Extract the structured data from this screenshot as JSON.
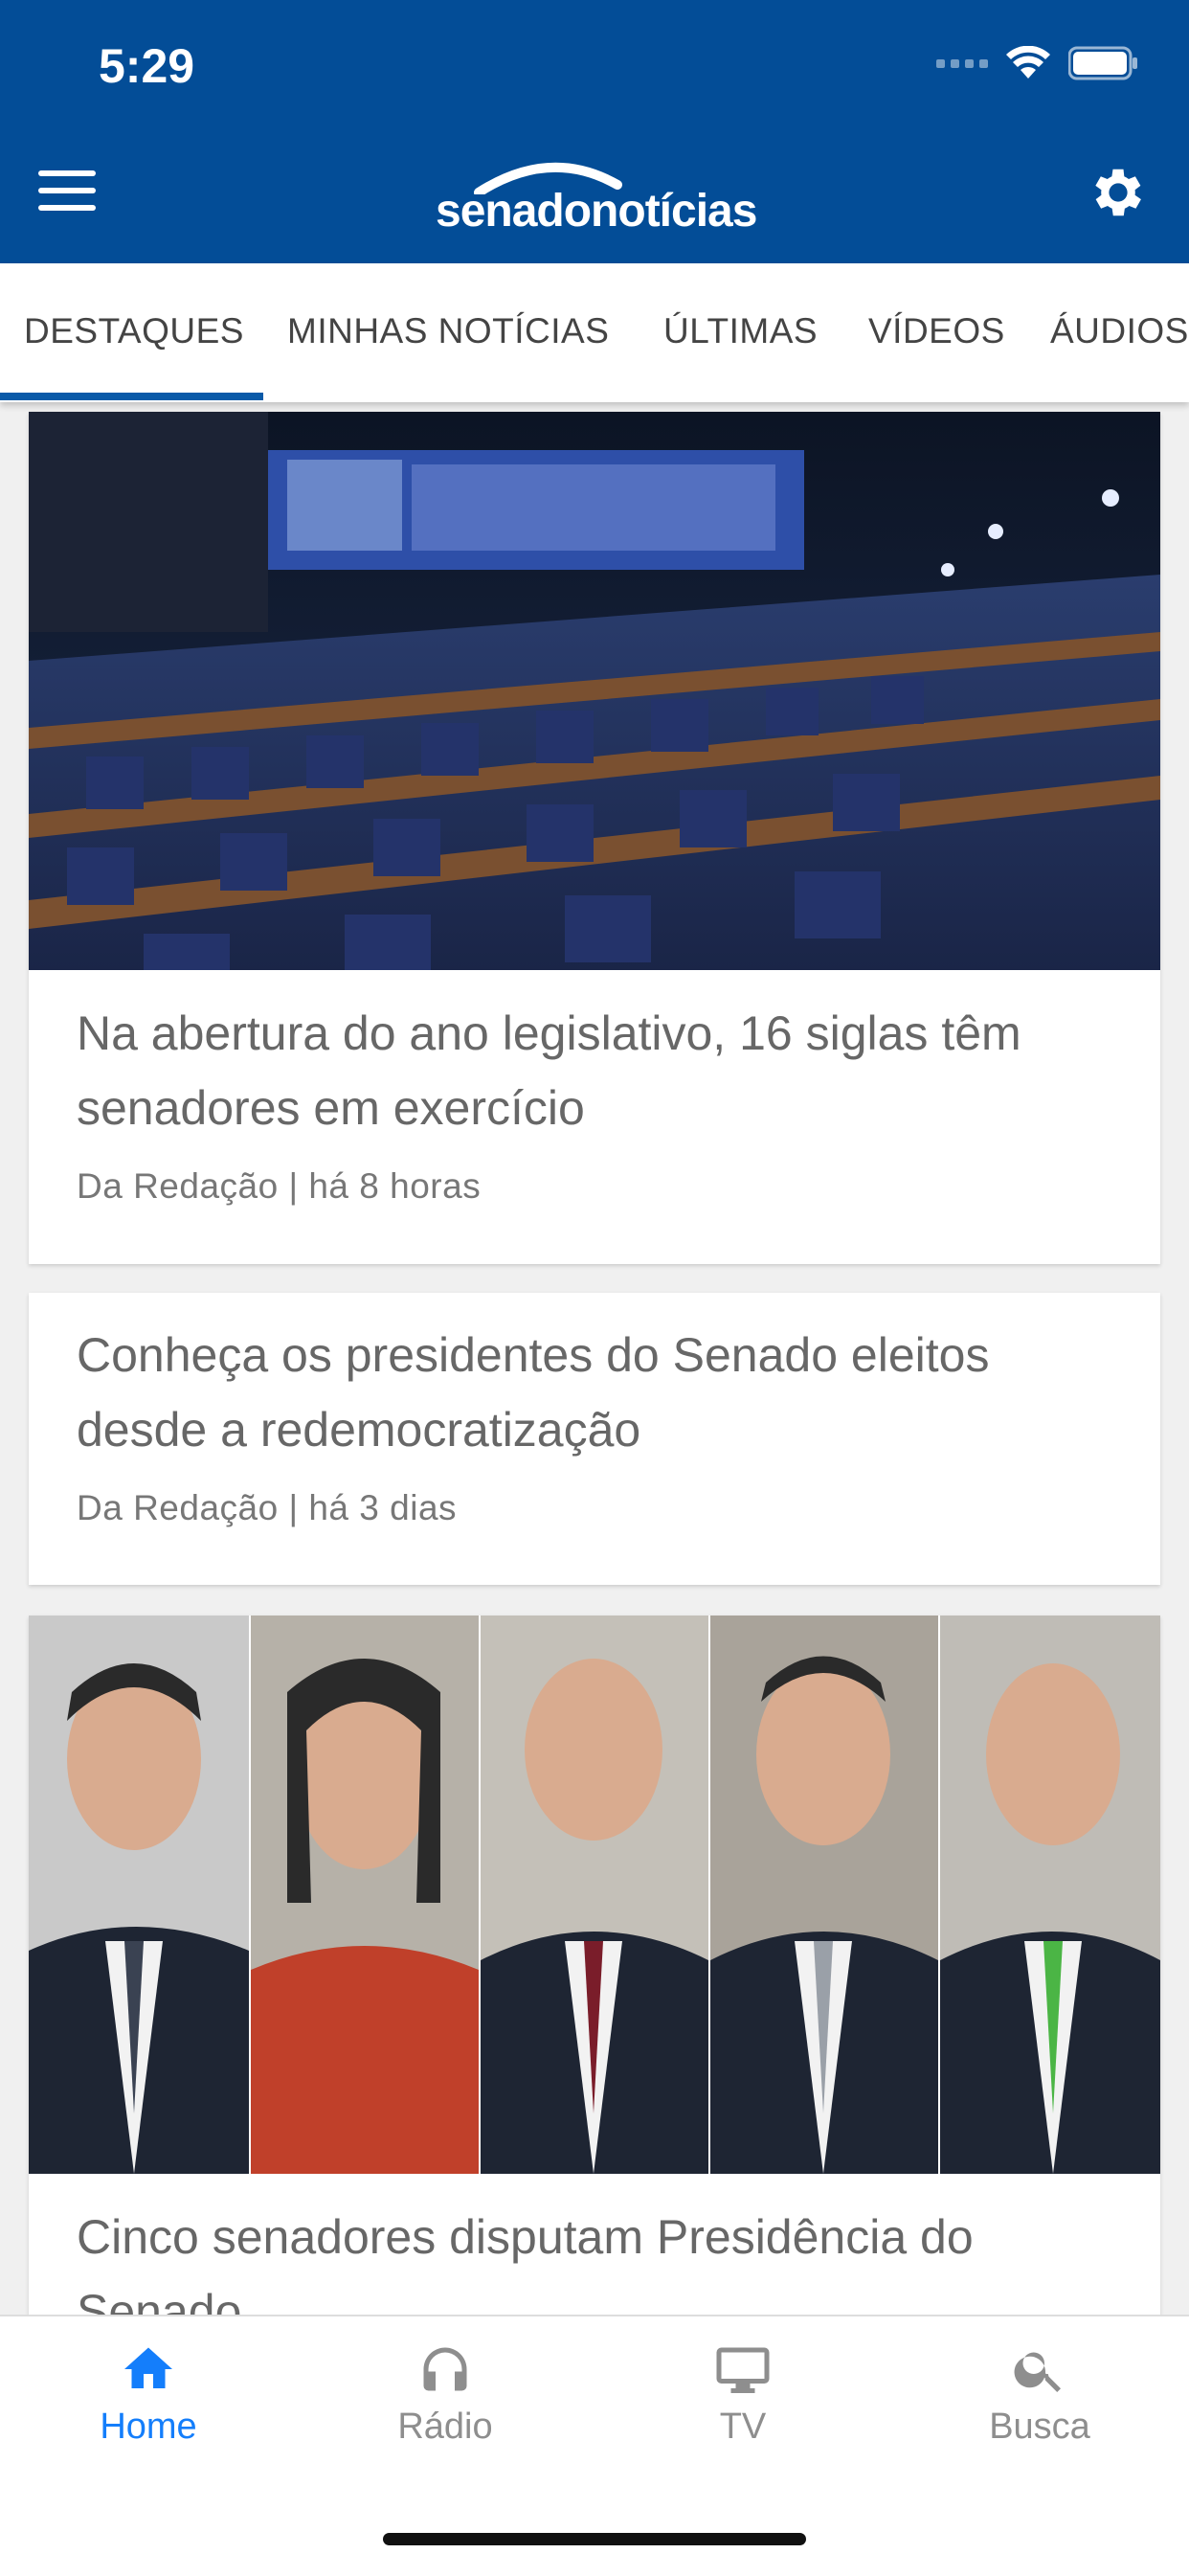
{
  "status": {
    "time": "5:29"
  },
  "header": {
    "logo_text": "senadonotícias"
  },
  "tabs": [
    {
      "label": "DESTAQUES",
      "active": true
    },
    {
      "label": "MINHAS NOTÍCIAS"
    },
    {
      "label": "ÚLTIMAS"
    },
    {
      "label": "VÍDEOS"
    },
    {
      "label": "ÁUDIOS"
    }
  ],
  "articles": [
    {
      "title": "Na abertura do ano legislativo, 16 siglas têm senadores em exercício",
      "meta": "Da Redação | há 8 horas",
      "image": "senate-plenary-photo"
    },
    {
      "title": "Conheça os presidentes do Senado eleitos desde a redemocratização",
      "meta": "Da Redação | há 3 dias"
    },
    {
      "title": "Cinco senadores disputam Presidência do Senado",
      "image": "five-senators-collage-photo"
    }
  ],
  "bottom_nav": [
    {
      "label": "Home",
      "icon": "home-icon",
      "active": true
    },
    {
      "label": "Rádio",
      "icon": "headphones-icon"
    },
    {
      "label": "TV",
      "icon": "tv-icon"
    },
    {
      "label": "Busca",
      "icon": "search-icon"
    }
  ],
  "colors": {
    "header_bg": "#034d97",
    "accent": "#147efb",
    "tab_indicator": "#0a5aa8"
  }
}
